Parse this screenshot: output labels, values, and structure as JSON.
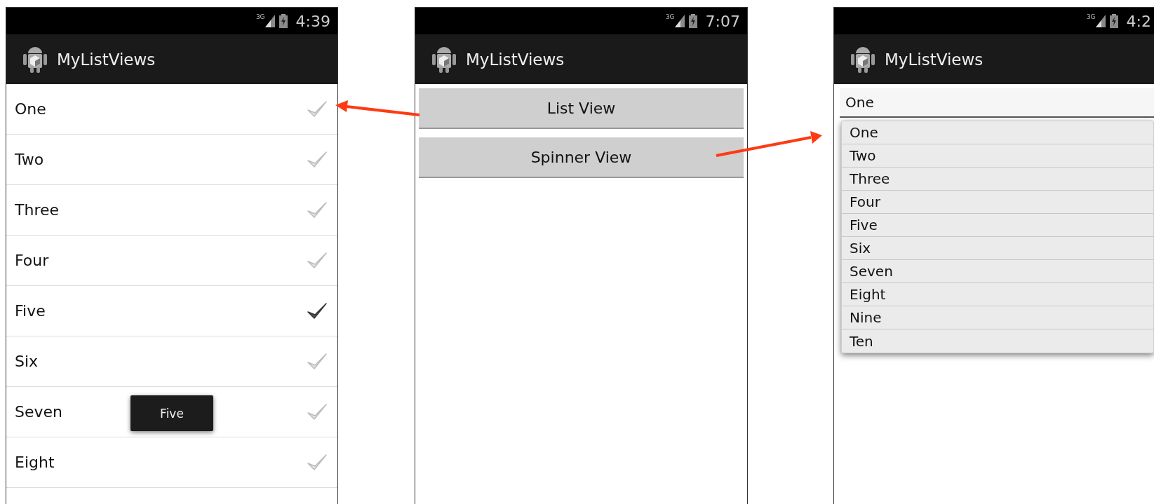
{
  "phones": [
    {
      "kind": "list",
      "status": {
        "network": "3G",
        "time": "4:39"
      },
      "title": "MyListViews",
      "items": [
        {
          "label": "One",
          "checked": false
        },
        {
          "label": "Two",
          "checked": false
        },
        {
          "label": "Three",
          "checked": false
        },
        {
          "label": "Four",
          "checked": false
        },
        {
          "label": "Five",
          "checked": true
        },
        {
          "label": "Six",
          "checked": false
        },
        {
          "label": "Seven",
          "checked": false
        },
        {
          "label": "Eight",
          "checked": false
        }
      ],
      "toast": "Five"
    },
    {
      "kind": "buttons",
      "status": {
        "network": "3G",
        "time": "7:07"
      },
      "title": "MyListViews",
      "buttons": [
        "List View",
        "Spinner View"
      ]
    },
    {
      "kind": "spinner",
      "status": {
        "network": "3G",
        "time": "4:2"
      },
      "title": "MyListViews",
      "spinner": {
        "value": "One",
        "expanded": true
      },
      "options": [
        "One",
        "Two",
        "Three",
        "Four",
        "Five",
        "Six",
        "Seven",
        "Eight",
        "Nine",
        "Ten"
      ]
    }
  ]
}
